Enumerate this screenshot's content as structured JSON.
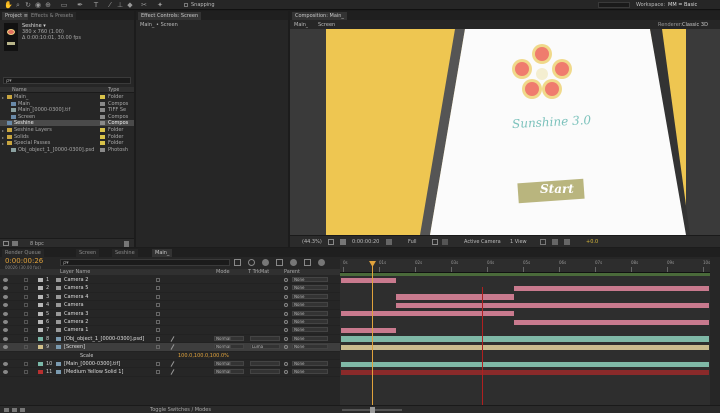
{
  "toolbar": {
    "snapping_label": "Snapping",
    "workspace_label": "Workspace:",
    "workspace_value": "MM = Basic",
    "search_placeholder": "Search Help",
    "tools": [
      "hand",
      "zoom",
      "rotate",
      "camera",
      "pan",
      "rect",
      "pen",
      "text",
      "brush",
      "clone",
      "eraser",
      "roto",
      "pin"
    ]
  },
  "project": {
    "tab1": "Project ≡",
    "tab2": "Effects & Presets",
    "comp_name": "Seshine ▾",
    "comp_size": "380 x 760 (1.00)",
    "comp_duration": "Δ 0:00:10:01, 30.00 fps",
    "search_placeholder": "ρ▾",
    "col_name": "Name",
    "col_type": "Type",
    "items": [
      {
        "name": "Main_",
        "type": "Folder",
        "indent": 0,
        "color": "#d8c24a",
        "kind": "folder"
      },
      {
        "name": "Main_",
        "type": "Compos",
        "indent": 1,
        "color": "#8a8a8a",
        "kind": "comp"
      },
      {
        "name": "Main_[0000-0300].tif",
        "type": "TIFF Se",
        "indent": 1,
        "color": "#8a8a8a",
        "kind": "file"
      },
      {
        "name": "Screen",
        "type": "Compos",
        "indent": 1,
        "color": "#8a8a8a",
        "kind": "comp"
      },
      {
        "name": "Seshine",
        "type": "Compos",
        "indent": 0,
        "color": "#8a8a8a",
        "kind": "comp",
        "selected": true
      },
      {
        "name": "Seshine Layers",
        "type": "Folder",
        "indent": 0,
        "color": "#d8c24a",
        "kind": "folder"
      },
      {
        "name": "Solids",
        "type": "Folder",
        "indent": 0,
        "color": "#d8c24a",
        "kind": "folder"
      },
      {
        "name": "Special Passes",
        "type": "Folder",
        "indent": 0,
        "color": "#d8c24a",
        "kind": "folder"
      },
      {
        "name": "Obj_object_1_[0000-0300].psd",
        "type": "Photosh",
        "indent": 1,
        "color": "#8a8a8a",
        "kind": "file"
      }
    ],
    "bpc": "8 bpc"
  },
  "effects": {
    "tab": "Effect Controls: Screen",
    "crumb": "Main_ • Screen"
  },
  "composition": {
    "tab": "Composition: Main_",
    "crumb1": "Main_",
    "crumb2": "Screen",
    "renderer_label": "Renderer:",
    "renderer_value": "Classic 3D",
    "zoom": "(44.3%)",
    "timecode": "0:00:00:20",
    "resolution": "Full",
    "camera": "Active Camera",
    "views": "1 View",
    "offset": "+0.0",
    "app_title": "Sunshine 3.0",
    "start_button": "Start"
  },
  "render_tabs": [
    "Render Queue",
    "Screen",
    "Seshine",
    "Main_"
  ],
  "timeline": {
    "timecode": "0:00:00:26",
    "frame_info": "00026 (30.00 fps)",
    "search_placeholder": "ρ▾",
    "col_layer_name": "Layer Name",
    "col_mode": "Mode",
    "col_trkmat": "T TrkMat",
    "col_parent": "Parent",
    "ruler_labels": [
      "0s",
      "01s",
      "02s",
      "03s",
      "04s",
      "05s",
      "06s",
      "07s",
      "08s",
      "09s",
      "10s"
    ],
    "scale_label": "Scale",
    "scale_value": "100.0,100.0,100.0%",
    "layers": [
      {
        "num": "1",
        "name": "Camera 2",
        "mode": "",
        "trk": "",
        "parent": "None",
        "color": "#b8b8b8",
        "bar": [
          0.0,
          0.15
        ],
        "bar_color": "#c97a8e"
      },
      {
        "num": "2",
        "name": "Camera 5",
        "mode": "",
        "trk": "",
        "parent": "None",
        "color": "#b8b8b8",
        "bar": [
          0.47,
          1.0
        ],
        "bar_color": "#c97a8e"
      },
      {
        "num": "3",
        "name": "Camera 4",
        "mode": "",
        "trk": "",
        "parent": "None",
        "color": "#b8b8b8",
        "bar": [
          0.15,
          0.47
        ],
        "bar_color": "#c97a8e"
      },
      {
        "num": "4",
        "name": "Camera",
        "mode": "",
        "trk": "",
        "parent": "None",
        "color": "#b8b8b8",
        "bar": [
          0.15,
          1.0
        ],
        "bar_color": "#c97a8e"
      },
      {
        "num": "5",
        "name": "Camera 3",
        "mode": "",
        "trk": "",
        "parent": "None",
        "color": "#b8b8b8",
        "bar": [
          0.0,
          0.47
        ],
        "bar_color": "#c97a8e"
      },
      {
        "num": "6",
        "name": "Camera 2",
        "mode": "",
        "trk": "",
        "parent": "None",
        "color": "#b8b8b8",
        "bar": [
          0.47,
          1.0
        ],
        "bar_color": "#c97a8e"
      },
      {
        "num": "7",
        "name": "Camera 1",
        "mode": "",
        "trk": "",
        "parent": "None",
        "color": "#b8b8b8",
        "bar": [
          0.0,
          0.15
        ],
        "bar_color": "#c97a8e"
      },
      {
        "num": "8",
        "name": "[Obj_object_1_[0000-0300].psd]",
        "mode": "Normal",
        "trk": "",
        "parent": "None",
        "color": "#7ab8a8",
        "bar": [
          0.0,
          1.0
        ],
        "bar_color": "#7fb8a6"
      },
      {
        "num": "9",
        "name": "[Screen]",
        "mode": "Normal",
        "trk": "Luma",
        "parent": "None",
        "color": "#d2c089",
        "bar": [
          0.0,
          1.0
        ],
        "bar_color": "#c9bb8e",
        "selected": true
      },
      {
        "num": "10",
        "name": "[Main_[0000-0300].tif]",
        "mode": "Normal",
        "trk": "",
        "parent": "None",
        "color": "#7ab8a8",
        "bar": [
          0.0,
          1.0
        ],
        "bar_color": "#7fb8a6"
      },
      {
        "num": "11",
        "name": "[Medium Yellow Solid 1]",
        "mode": "Normal",
        "trk": "",
        "parent": "None",
        "color": "#b83030",
        "bar": [
          0.0,
          1.0
        ],
        "bar_color": "#8a2a2a"
      }
    ],
    "toggle_label": "Toggle Switches / Modes"
  }
}
